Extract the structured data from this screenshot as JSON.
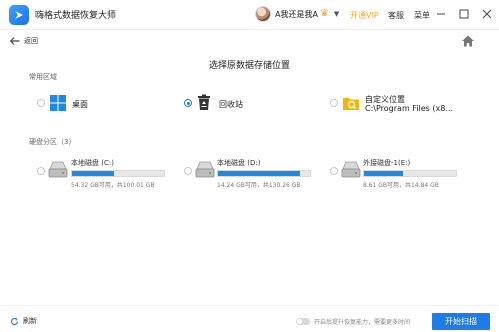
{
  "app": {
    "title": "嗨格式数据恢复大师"
  },
  "header": {
    "username": "A我还是我A",
    "vip_label": "开通VIP",
    "service_label": "客服",
    "menu_label": "菜单",
    "accent_color": "#1e7be8",
    "vip_color": "#f5a623"
  },
  "nav": {
    "back_label": "返回"
  },
  "main": {
    "heading": "选择原数据存储位置",
    "common_section_label": "常用区域",
    "locations": [
      {
        "icon": "windows-desktop-icon",
        "label": "桌面",
        "selected": false
      },
      {
        "icon": "recycle-bin-icon",
        "label": "回收站",
        "selected": true
      },
      {
        "icon": "custom-folder-icon",
        "label": "自定义位置",
        "path": "C:\\Program Files (x8...",
        "selected": false
      }
    ],
    "drive_section_label": "硬盘分区（3）",
    "drives": [
      {
        "name": "本地磁盘 (C:)",
        "size": "54.32 GB可用，共100.01 GB",
        "used_fraction": 0.457
      },
      {
        "name": "本地磁盘 (D:)",
        "size": "14.24 GB可用，共130.26 GB",
        "used_fraction": 0.891
      },
      {
        "name": "外接磁盘-1(E:)",
        "size": "8.61 GB可用，共14.84 GB",
        "used_fraction": 0.42
      }
    ]
  },
  "footer": {
    "refresh_label": "刷新",
    "hint": "开启后提升恢复能力，需要更多时间",
    "scan_button": "开始扫描",
    "toggle_on": false
  }
}
